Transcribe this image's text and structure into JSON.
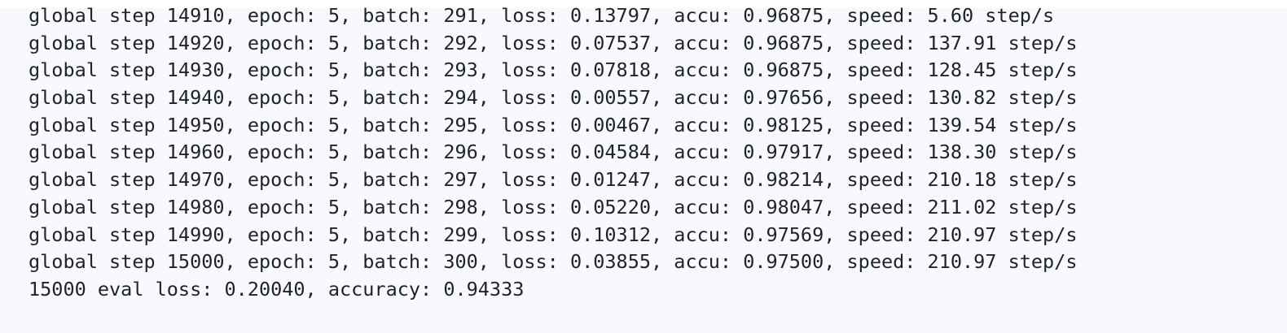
{
  "training_log": {
    "lines": [
      "global step 14910, epoch: 5, batch: 291, loss: 0.13797, accu: 0.96875, speed: 5.60 step/s",
      "global step 14920, epoch: 5, batch: 292, loss: 0.07537, accu: 0.96875, speed: 137.91 step/s",
      "global step 14930, epoch: 5, batch: 293, loss: 0.07818, accu: 0.96875, speed: 128.45 step/s",
      "global step 14940, epoch: 5, batch: 294, loss: 0.00557, accu: 0.97656, speed: 130.82 step/s",
      "global step 14950, epoch: 5, batch: 295, loss: 0.00467, accu: 0.98125, speed: 139.54 step/s",
      "global step 14960, epoch: 5, batch: 296, loss: 0.04584, accu: 0.97917, speed: 138.30 step/s",
      "global step 14970, epoch: 5, batch: 297, loss: 0.01247, accu: 0.98214, speed: 210.18 step/s",
      "global step 14980, epoch: 5, batch: 298, loss: 0.05220, accu: 0.98047, speed: 211.02 step/s",
      "global step 14990, epoch: 5, batch: 299, loss: 0.10312, accu: 0.97569, speed: 210.97 step/s",
      "global step 15000, epoch: 5, batch: 300, loss: 0.03855, accu: 0.97500, speed: 210.97 step/s"
    ],
    "eval_line": "15000 eval loss: 0.20040, accuracy: 0.94333"
  },
  "colors": {
    "panel_background": "#f8f9fc",
    "text": "#1f2328"
  }
}
